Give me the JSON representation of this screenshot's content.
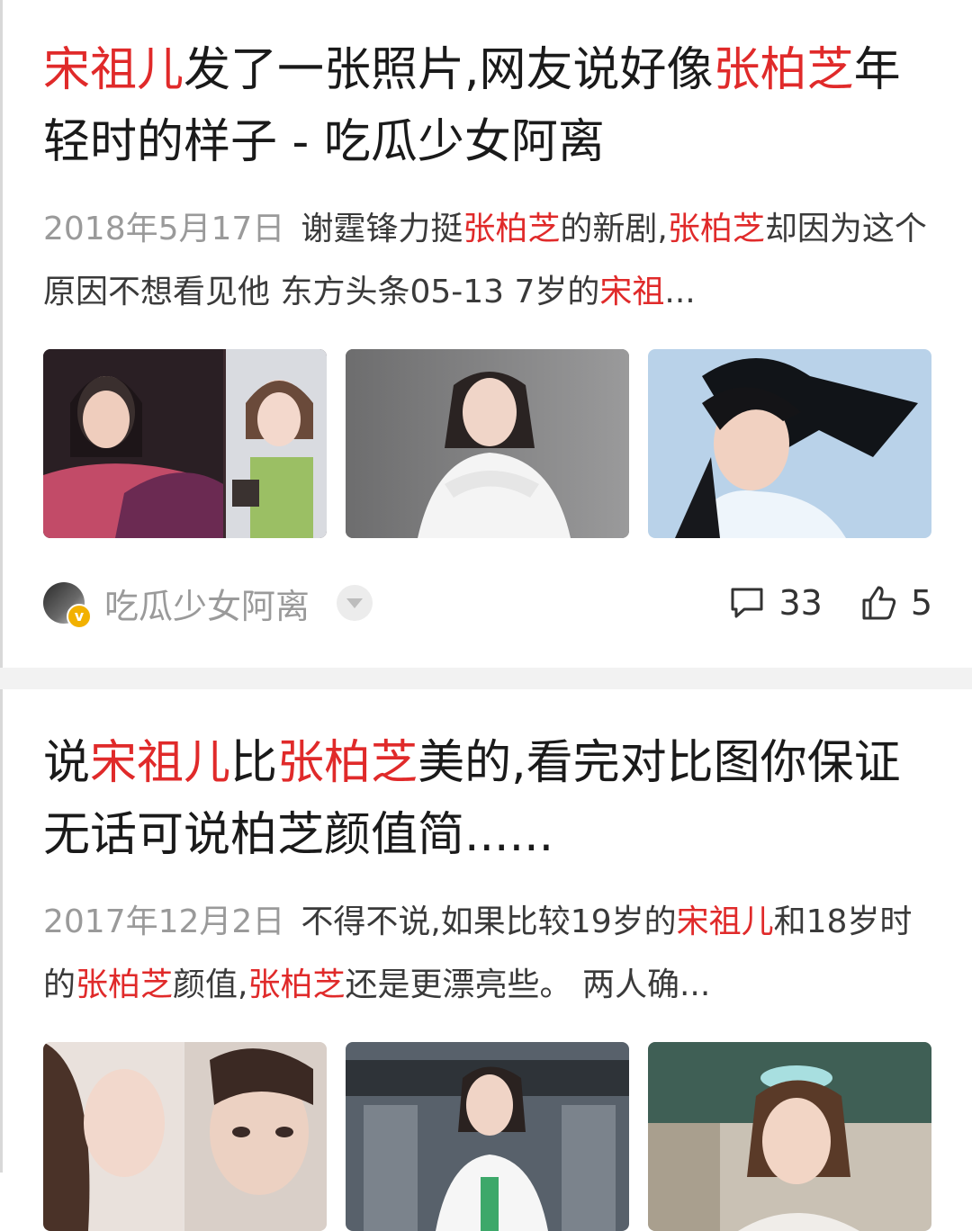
{
  "feed": [
    {
      "title_parts": [
        {
          "text": "宋祖儿",
          "hl": true
        },
        {
          "text": "发了一张照片,网友说好像",
          "hl": false
        },
        {
          "text": "张柏芝",
          "hl": true
        },
        {
          "text": "年轻时的样子 - 吃瓜少女阿离",
          "hl": false
        }
      ],
      "date": "2018年5月17日",
      "snippet_parts": [
        {
          "text": "谢霆锋力挺",
          "hl": false
        },
        {
          "text": "张柏芝",
          "hl": true
        },
        {
          "text": "的新剧,",
          "hl": false
        },
        {
          "text": "张柏芝",
          "hl": true
        },
        {
          "text": "却因为这个原因不想看见他 东方头条05-13 7岁的",
          "hl": false
        },
        {
          "text": "宋祖",
          "hl": true
        },
        {
          "text": "...",
          "hl": false
        }
      ],
      "author": "吃瓜少女阿离",
      "comments": "33",
      "likes": "5"
    },
    {
      "title_parts": [
        {
          "text": "说",
          "hl": false
        },
        {
          "text": "宋祖儿",
          "hl": true
        },
        {
          "text": "比",
          "hl": false
        },
        {
          "text": "张柏芝",
          "hl": true
        },
        {
          "text": "美的,看完对比图你保证无话可说柏芝颜值简......",
          "hl": false
        }
      ],
      "date": "2017年12月2日",
      "snippet_parts": [
        {
          "text": "不得不说,如果比较19岁的",
          "hl": false
        },
        {
          "text": "宋祖儿",
          "hl": true
        },
        {
          "text": "和18岁时的",
          "hl": false
        },
        {
          "text": "张柏芝",
          "hl": true
        },
        {
          "text": "颜值,",
          "hl": false
        },
        {
          "text": "张柏芝",
          "hl": true
        },
        {
          "text": "还是更漂亮些。 两人确...",
          "hl": false
        }
      ]
    }
  ],
  "colors": {
    "highlight": "#e02a2a",
    "date": "#9a9a9a",
    "divider": "#f2f2f2"
  },
  "icons": {
    "comment": "comment-icon",
    "like": "thumbs-up-icon",
    "dropdown": "chevron-down-icon",
    "verified": "verified-badge-icon"
  }
}
